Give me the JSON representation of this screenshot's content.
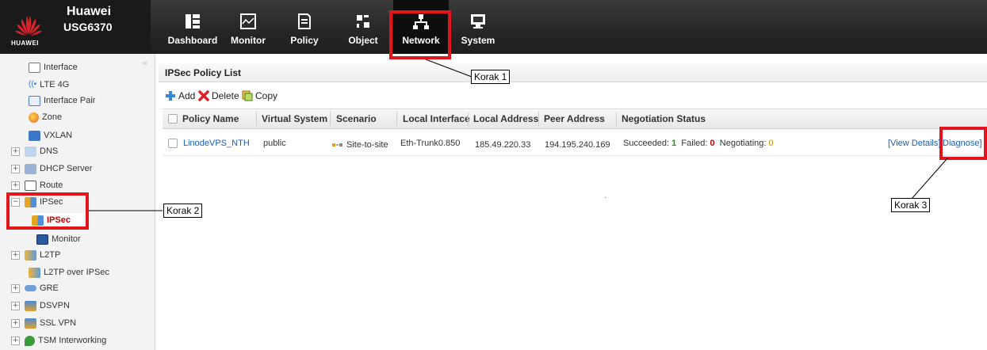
{
  "brand": {
    "logo_text": "HUAWEI",
    "line1": "Huawei",
    "line2": "USG6370"
  },
  "nav": [
    {
      "label": "Dashboard",
      "icon": "dashboard-icon"
    },
    {
      "label": "Monitor",
      "icon": "monitor-icon"
    },
    {
      "label": "Policy",
      "icon": "policy-icon"
    },
    {
      "label": "Object",
      "icon": "object-icon"
    },
    {
      "label": "Network",
      "icon": "network-icon",
      "active": true
    },
    {
      "label": "System",
      "icon": "system-icon"
    }
  ],
  "sidebar": {
    "collapse": "«",
    "items": [
      {
        "label": "Interface",
        "icon": "interface-icon"
      },
      {
        "label": "LTE 4G",
        "icon": "lte-icon"
      },
      {
        "label": "Interface Pair",
        "icon": "interface-pair-icon"
      },
      {
        "label": "Zone",
        "icon": "zone-icon"
      },
      {
        "label": "VXLAN",
        "icon": "vxlan-icon"
      },
      {
        "label": "DNS",
        "icon": "dns-icon"
      },
      {
        "label": "DHCP Server",
        "icon": "dhcp-icon"
      },
      {
        "label": "Route",
        "icon": "route-icon"
      },
      {
        "label": "IPSec",
        "icon": "ipsec-icon"
      },
      {
        "label": "IPSec",
        "icon": "ipsec-icon"
      },
      {
        "label": "Monitor",
        "icon": "monitor-icon"
      },
      {
        "label": "L2TP",
        "icon": "l2tp-icon"
      },
      {
        "label": "L2TP over IPSec",
        "icon": "l2tp-ipsec-icon"
      },
      {
        "label": "GRE",
        "icon": "gre-icon"
      },
      {
        "label": "DSVPN",
        "icon": "dsvpn-icon"
      },
      {
        "label": "SSL VPN",
        "icon": "ssl-vpn-icon"
      },
      {
        "label": "TSM Interworking",
        "icon": "tsm-icon"
      }
    ],
    "expander_plus": "+",
    "expander_minus": "−"
  },
  "main": {
    "title": "IPSec Policy List",
    "toolbar": {
      "add": "Add",
      "delete": "Delete",
      "copy": "Copy"
    },
    "columns": [
      "Policy Name",
      "Virtual System",
      "Scenario",
      "Local Interface",
      "Local Address",
      "Peer Address",
      "Negotiation Status"
    ],
    "row": {
      "policy_name": "LinodeVPS_NTH",
      "virtual_system": "public",
      "scenario": "Site-to-site",
      "local_interface": "Eth-Trunk0.850",
      "local_address": "185.49.220.33",
      "peer_address": "194.195.240.169",
      "succeeded_label": "Succeeded:",
      "succeeded": "1",
      "failed_label": "Failed:",
      "failed": "0",
      "negotiating_label": "Negotiating:",
      "negotiating": "0",
      "view_details": "[View Details]",
      "diagnose": "Diagnose]"
    }
  },
  "callouts": {
    "korak1": "Korak 1",
    "korak2": "Korak 2",
    "korak3": "Korak 3"
  },
  "colors": {
    "highlight": "#e4141b",
    "succeeded": "#2e8b22",
    "failed": "#c00000",
    "negotiating": "#d08a00",
    "link": "#1a5fb4"
  }
}
